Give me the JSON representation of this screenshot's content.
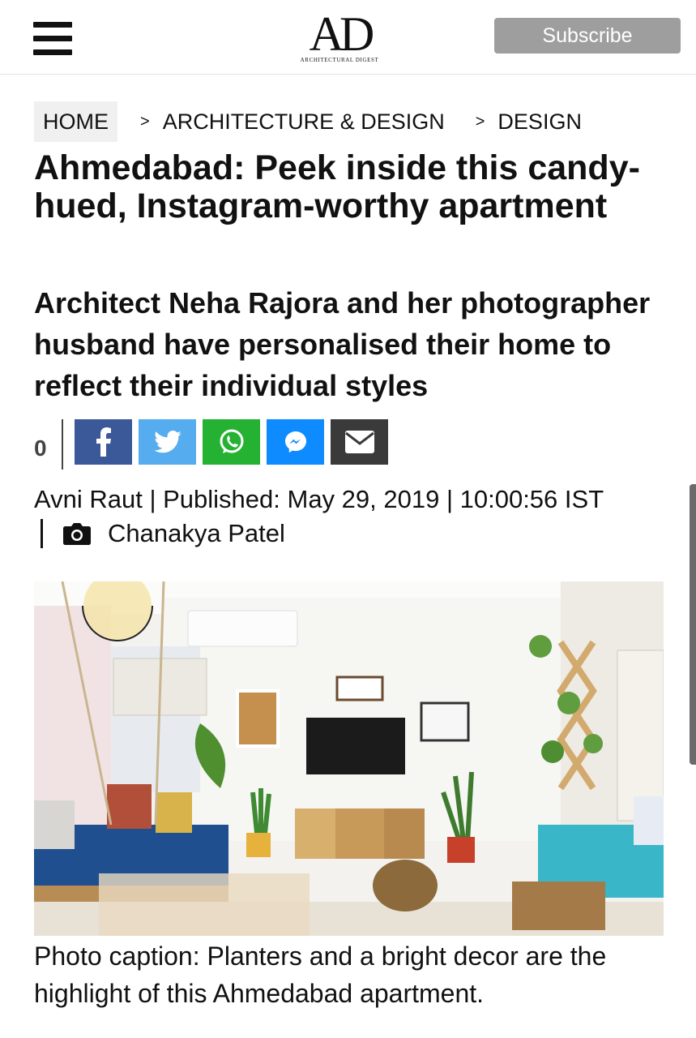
{
  "header": {
    "logo_text": "AD",
    "logo_subtitle": "ARCHITECTURAL DIGEST",
    "subscribe_label": "Subscribe"
  },
  "breadcrumb": {
    "home": "HOME",
    "separator": ">",
    "section": "ARCHITECTURE & DESIGN",
    "subsection": "DESIGN"
  },
  "article": {
    "title": "Ahmedabad: Peek inside this candy-hued, Instagram-worthy apartment",
    "subtitle": "Architect Neha Rajora and her photographer husband have personalised their home to reflect their individual styles",
    "share_count": "0",
    "byline": "Avni Raut | Published: May 29, 2019 | 10:00:56 IST",
    "photographer": "Chanakya Patel",
    "caption": "Photo caption: Planters and a bright decor are the highlight of this Ahmedabad apartment."
  },
  "share_buttons": [
    {
      "name": "facebook",
      "icon": "facebook-icon",
      "color": "#3b5998"
    },
    {
      "name": "twitter",
      "icon": "twitter-icon",
      "color": "#55acee"
    },
    {
      "name": "whatsapp",
      "icon": "whatsapp-icon",
      "color": "#25b131"
    },
    {
      "name": "messenger",
      "icon": "messenger-icon",
      "color": "#0d8bff"
    },
    {
      "name": "email",
      "icon": "envelope-icon",
      "color": "#3a3a3a"
    }
  ],
  "colors": {
    "subscribe_bg": "#9e9e9e",
    "text": "#111111",
    "breadcrumb_home_bg": "#f0f0f0"
  }
}
